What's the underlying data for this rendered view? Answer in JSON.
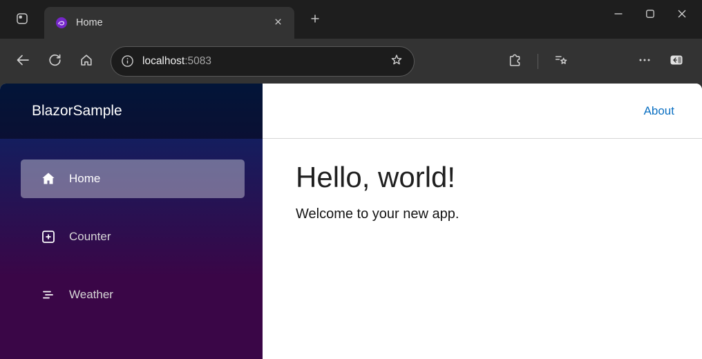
{
  "browser": {
    "tab_title": "Home",
    "address_host": "localhost",
    "address_port": ":5083"
  },
  "app": {
    "brand": "BlazorSample",
    "nav": [
      {
        "label": "Home",
        "icon": "house-icon",
        "active": true
      },
      {
        "label": "Counter",
        "icon": "plus-square-icon",
        "active": false
      },
      {
        "label": "Weather",
        "icon": "list-icon",
        "active": false
      }
    ],
    "about_label": "About",
    "title": "Hello, world!",
    "subtitle": "Welcome to your new app."
  },
  "colors": {
    "chrome_bg": "#1e1e1e",
    "chrome_surface": "#333333",
    "addressbar_bg": "#1c1c1c",
    "sidebar_top": "#052767",
    "sidebar_bottom": "#3a0647",
    "nav_active_bg": "rgba(255,255,255,0.37)",
    "about_link": "#0a6fc2",
    "blazor_purple": "#7526c9"
  }
}
